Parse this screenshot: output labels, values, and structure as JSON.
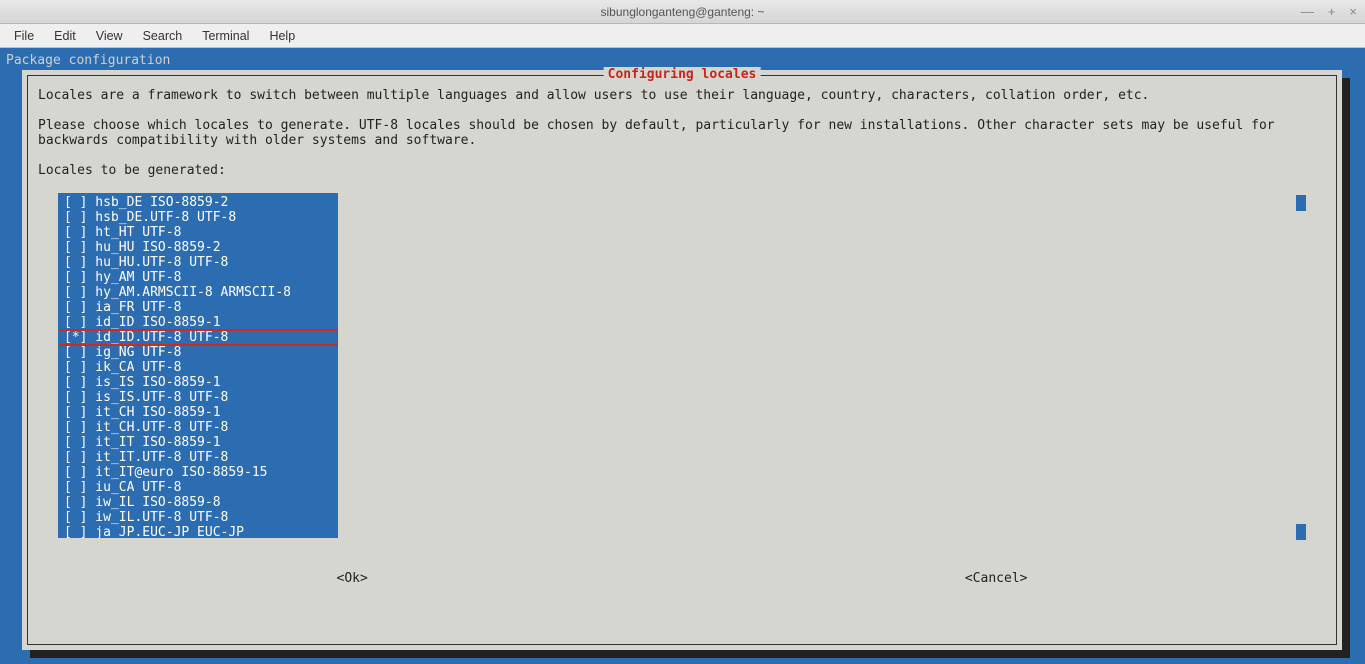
{
  "window": {
    "title": "sibunglonganteng@ganteng: ~"
  },
  "menubar": {
    "items": [
      "File",
      "Edit",
      "View",
      "Search",
      "Terminal",
      "Help"
    ]
  },
  "terminal": {
    "header": "Package configuration"
  },
  "dialog": {
    "title": "Configuring locales",
    "intro1": "Locales are a framework to switch between multiple languages and allow users to use their language, country, characters, collation order, etc.",
    "intro2": "Please choose which locales to generate. UTF-8 locales should be chosen by default, particularly for new installations. Other character sets may be useful for backwards compatibility with older systems and software.",
    "prompt": "Locales to be generated:",
    "ok": "<Ok>",
    "cancel": "<Cancel>"
  },
  "locales": [
    {
      "checked": false,
      "label": "hsb_DE ISO-8859-2",
      "highlight": false
    },
    {
      "checked": false,
      "label": "hsb_DE.UTF-8 UTF-8",
      "highlight": false
    },
    {
      "checked": false,
      "label": "ht_HT UTF-8",
      "highlight": false
    },
    {
      "checked": false,
      "label": "hu_HU ISO-8859-2",
      "highlight": false
    },
    {
      "checked": false,
      "label": "hu_HU.UTF-8 UTF-8",
      "highlight": false
    },
    {
      "checked": false,
      "label": "hy_AM UTF-8",
      "highlight": false
    },
    {
      "checked": false,
      "label": "hy_AM.ARMSCII-8 ARMSCII-8",
      "highlight": false
    },
    {
      "checked": false,
      "label": "ia_FR UTF-8",
      "highlight": false
    },
    {
      "checked": false,
      "label": "id_ID ISO-8859-1",
      "highlight": false
    },
    {
      "checked": true,
      "label": "id_ID.UTF-8 UTF-8",
      "highlight": true
    },
    {
      "checked": false,
      "label": "ig_NG UTF-8",
      "highlight": false
    },
    {
      "checked": false,
      "label": "ik_CA UTF-8",
      "highlight": false
    },
    {
      "checked": false,
      "label": "is_IS ISO-8859-1",
      "highlight": false
    },
    {
      "checked": false,
      "label": "is_IS.UTF-8 UTF-8",
      "highlight": false
    },
    {
      "checked": false,
      "label": "it_CH ISO-8859-1",
      "highlight": false
    },
    {
      "checked": false,
      "label": "it_CH.UTF-8 UTF-8",
      "highlight": false
    },
    {
      "checked": false,
      "label": "it_IT ISO-8859-1",
      "highlight": false
    },
    {
      "checked": false,
      "label": "it_IT.UTF-8 UTF-8",
      "highlight": false
    },
    {
      "checked": false,
      "label": "it_IT@euro ISO-8859-15",
      "highlight": false
    },
    {
      "checked": false,
      "label": "iu_CA UTF-8",
      "highlight": false
    },
    {
      "checked": false,
      "label": "iw_IL ISO-8859-8",
      "highlight": false
    },
    {
      "checked": false,
      "label": "iw_IL.UTF-8 UTF-8",
      "highlight": false
    },
    {
      "checked": false,
      "label": "ja_JP.EUC-JP EUC-JP",
      "highlight": false
    }
  ]
}
